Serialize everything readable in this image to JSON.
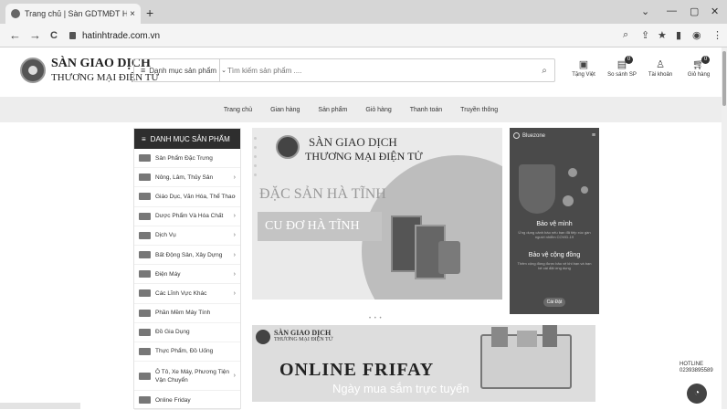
{
  "browser": {
    "tab_title": "Trang chủ | Sàn GDTMĐT Hà Tĩnh",
    "tab_close": "×",
    "new_tab": "+",
    "url": "hatinhtrade.com.vn",
    "back": "←",
    "forward": "→",
    "reload": "C",
    "win_min": "—",
    "win_max": "▢",
    "win_close": "✕",
    "win_down": "⌄"
  },
  "site": {
    "logo_line1": "SÀN GIAO DỊCH",
    "logo_line2": "THƯƠNG MẠI ĐIỆN TỬ",
    "category_select": "Danh mục sản phẩm",
    "search_placeholder": "Tìm kiếm sản phẩm ....",
    "header_icons": [
      {
        "label": "Tặng Việt",
        "icon": "tv-icon"
      },
      {
        "label": "So sánh SP",
        "icon": "compare-icon",
        "badge": "0"
      },
      {
        "label": "Tài khoản",
        "icon": "user-icon"
      },
      {
        "label": "Giỏ hàng",
        "icon": "cart-icon",
        "badge": "0"
      }
    ]
  },
  "nav": [
    "Trang chủ",
    "Gian hàng",
    "Sản phẩm",
    "Giỏ hàng",
    "Thanh toán",
    "Truyền thông"
  ],
  "category_menu": {
    "title": "DANH MỤC SẢN PHẨM",
    "items": [
      {
        "label": "Sản Phẩm Đặc Trưng",
        "arrow": false
      },
      {
        "label": "Nông, Lâm, Thủy Sản",
        "arrow": true
      },
      {
        "label": "Giáo Dục, Văn Hóa, Thể Thao",
        "arrow": true
      },
      {
        "label": "Dược Phẩm Và Hóa Chất",
        "arrow": true
      },
      {
        "label": "Dịch Vụ",
        "arrow": true
      },
      {
        "label": "Bất Động Sản, Xây Dựng",
        "arrow": true
      },
      {
        "label": "Điện Máy",
        "arrow": true
      },
      {
        "label": "Các Lĩnh Vực Khác",
        "arrow": true
      },
      {
        "label": "Phần Mềm Máy Tính",
        "arrow": false
      },
      {
        "label": "Đồ Gia Dụng",
        "arrow": false
      },
      {
        "label": "Thực Phẩm, Đồ Uống",
        "arrow": false
      },
      {
        "label": "Ô Tô, Xe Máy, Phương Tiện Vận Chuyển",
        "arrow": true
      },
      {
        "label": "Online Friday",
        "arrow": false
      }
    ]
  },
  "banner": {
    "line1": "SÀN GIAO DỊCH",
    "line2": "THƯƠNG MẠI ĐIỆN TỬ",
    "dac_san": "ĐẶC SẢN HÀ TĨNH",
    "cu_do": "CU ĐƠ HÀ TĨNH",
    "dots": "• • •"
  },
  "phone_ad": {
    "brand": "Bluezone",
    "heading1": "Bảo vệ mình",
    "sub1": "Ứng dụng cảnh báo nếu bạn đã tiếp xúc gần người nhiễm COVID-19",
    "heading2": "Bảo vệ cộng đồng",
    "sub2": "Thêm cộng đồng được bảo vệ khi bạn và bạn bè cài đặt ứng dụng",
    "button": "Cài Đặt"
  },
  "friday_banner": {
    "line1": "SÀN GIAO DỊCH",
    "line2": "THƯƠNG MẠI ĐIỆN TỬ",
    "title": "ONLINE FRIFAY",
    "subtitle": "Ngày mua sắm trực tuyến"
  },
  "hotline": {
    "label": "HOTLINE",
    "number": "02393895589"
  }
}
